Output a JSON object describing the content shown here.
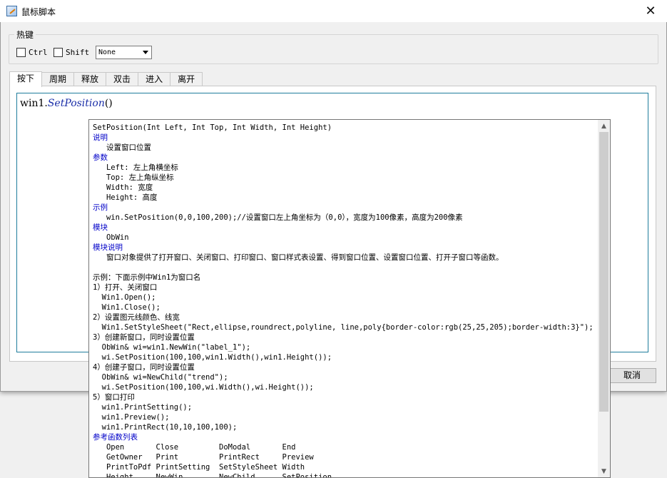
{
  "window": {
    "title": "鼠标脚本",
    "close_glyph": "✕"
  },
  "hotkey": {
    "group_label": "热键",
    "ctrl_label": "Ctrl",
    "shift_label": "Shift",
    "key_select_value": "None"
  },
  "tabs": [
    {
      "label": "按下",
      "active": true
    },
    {
      "label": "周期"
    },
    {
      "label": "释放"
    },
    {
      "label": "双击"
    },
    {
      "label": "进入"
    },
    {
      "label": "离开"
    }
  ],
  "editor": {
    "object": "win1.",
    "method": "SetPosition",
    "parens": "()"
  },
  "buttons": {
    "cancel_label": "取消"
  },
  "tooltip": {
    "lines": [
      {
        "t": "SetPosition(Int Left, Int Top, Int Width, Int Height)"
      },
      {
        "t": "说明",
        "hd": true
      },
      {
        "t": "   设置窗口位置"
      },
      {
        "t": "参数",
        "hd": true
      },
      {
        "t": "   Left: 左上角横坐标"
      },
      {
        "t": "   Top: 左上角纵坐标"
      },
      {
        "t": "   Width: 宽度"
      },
      {
        "t": "   Height: 高度"
      },
      {
        "t": "示例",
        "hd": true
      },
      {
        "t": "   win.SetPosition(0,0,100,200);//设置窗口左上角坐标为（0,0），宽度为100像素，高度为200像素"
      },
      {
        "t": "模块",
        "hd": true
      },
      {
        "t": "   ObWin"
      },
      {
        "t": "模块说明",
        "hd": true
      },
      {
        "t": "   窗口对象提供了打开窗口、关闭窗口、打印窗口、窗口样式表设置、得到窗口位置、设置窗口位置、打开子窗口等函数。"
      },
      {
        "t": ""
      },
      {
        "t": "示例：下面示例中Win1为窗口名"
      },
      {
        "t": "1）打开、关闭窗口"
      },
      {
        "t": "  Win1.Open();"
      },
      {
        "t": "  Win1.Close();"
      },
      {
        "t": "2）设置图元线颜色、线宽"
      },
      {
        "t": "  Win1.SetStyleSheet(\"Rect,ellipse,roundrect,polyline, line,poly{border-color:rgb(25,25,205);border-width:3}\");"
      },
      {
        "t": "3）创建新窗口，同时设置位置"
      },
      {
        "t": "  ObWin& wi=win1.NewWin(\"label_1\");"
      },
      {
        "t": "  wi.SetPosition(100,100,win1.Width(),win1.Height());"
      },
      {
        "t": "4）创建子窗口，同时设置位置"
      },
      {
        "t": "  ObWin& wi=NewChild(\"trend\");"
      },
      {
        "t": "  wi.SetPosition(100,100,wi.Width(),wi.Height());"
      },
      {
        "t": "5）窗口打印"
      },
      {
        "t": "  win1.PrintSetting();"
      },
      {
        "t": "  win1.Preview();"
      },
      {
        "t": "  win1.PrintRect(10,10,100,100);"
      },
      {
        "t": "参考函数列表",
        "hd": true
      },
      {
        "t": "   Open       Close         DoModal       End"
      },
      {
        "t": "   GetOwner   Print         PrintRect     Preview"
      },
      {
        "t": "   PrintToPdf PrintSetting  SetStyleSheet Width"
      },
      {
        "t": "   Height     NewWin        NewChild      SetPosition"
      }
    ]
  }
}
